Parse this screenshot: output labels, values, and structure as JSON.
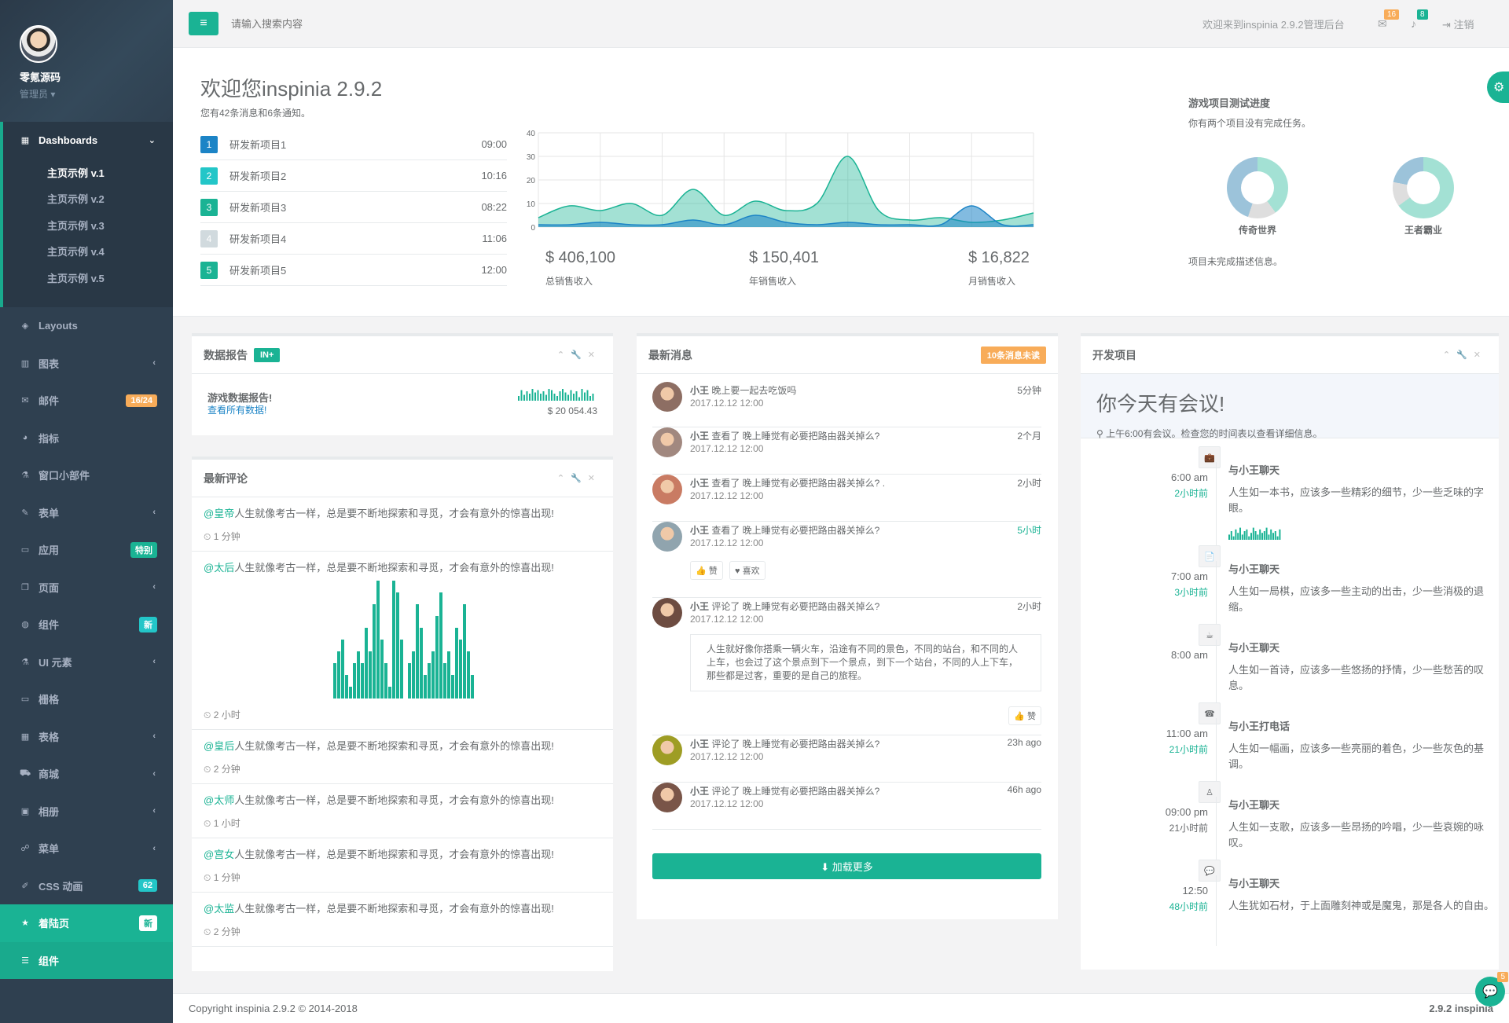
{
  "profile": {
    "name": "零氪源码",
    "role": "管理员 ▾"
  },
  "nav": {
    "dashboards": "Dashboards",
    "sub": [
      "主页示例 v.1",
      "主页示例 v.2",
      "主页示例 v.3",
      "主页示例 v.4",
      "主页示例 v.5"
    ],
    "items": [
      {
        "label": "Layouts",
        "icon": "◈",
        "arrow": "",
        "badge": "",
        "badge_class": ""
      },
      {
        "label": "图表",
        "icon": "▥",
        "arrow": "‹",
        "badge": "",
        "badge_class": ""
      },
      {
        "label": "邮件",
        "icon": "✉",
        "arrow": "",
        "badge": "16/24",
        "badge_class": "b-warn"
      },
      {
        "label": "指标",
        "icon": "◕",
        "arrow": "",
        "badge": "",
        "badge_class": ""
      },
      {
        "label": "窗口小部件",
        "icon": "⚗",
        "arrow": "",
        "badge": "",
        "badge_class": ""
      },
      {
        "label": "表单",
        "icon": "✎",
        "arrow": "‹",
        "badge": "",
        "badge_class": ""
      },
      {
        "label": "应用",
        "icon": "▭",
        "arrow": "",
        "badge": "特别",
        "badge_class": "b-pri"
      },
      {
        "label": "页面",
        "icon": "❐",
        "arrow": "‹",
        "badge": "",
        "badge_class": ""
      },
      {
        "label": "组件",
        "icon": "◍",
        "arrow": "",
        "badge": "新",
        "badge_class": "b-info"
      },
      {
        "label": "UI 元素",
        "icon": "⚗",
        "arrow": "‹",
        "badge": "",
        "badge_class": ""
      },
      {
        "label": "栅格",
        "icon": "▭",
        "arrow": "",
        "badge": "",
        "badge_class": ""
      },
      {
        "label": "表格",
        "icon": "▦",
        "arrow": "‹",
        "badge": "",
        "badge_class": ""
      },
      {
        "label": "商城",
        "icon": "⛟",
        "arrow": "‹",
        "badge": "",
        "badge_class": ""
      },
      {
        "label": "相册",
        "icon": "▣",
        "arrow": "‹",
        "badge": "",
        "badge_class": ""
      },
      {
        "label": "菜单",
        "icon": "☍",
        "arrow": "‹",
        "badge": "",
        "badge_class": ""
      },
      {
        "label": "CSS 动画",
        "icon": "✐",
        "arrow": "",
        "badge": "62",
        "badge_class": "b-info"
      }
    ],
    "landing": "着陆页",
    "landing_badge": "新",
    "bottom": "组件"
  },
  "topbar": {
    "search_placeholder": "请输入搜索内容",
    "welcome": "欢迎来到inspinia 2.9.2管理后台",
    "mail_count": "16",
    "bell_count": "8",
    "logout": "注销"
  },
  "hero": {
    "title": "欢迎您inspinia 2.9.2",
    "subtitle": "您有42条消息和6条通知。",
    "projects": [
      {
        "n": "1",
        "name": "研发新项目1",
        "time": "09:00",
        "color": "#1c84c6"
      },
      {
        "n": "2",
        "name": "研发新项目2",
        "time": "10:16",
        "color": "#23c6c8"
      },
      {
        "n": "3",
        "name": "研发新项目3",
        "time": "08:22",
        "color": "#1ab394"
      },
      {
        "n": "4",
        "name": "研发新项目4",
        "time": "11:06",
        "color": "#d1dade"
      },
      {
        "n": "5",
        "name": "研发新项目5",
        "time": "12:00",
        "color": "#1ab394"
      }
    ],
    "stats": [
      {
        "value": "$ 406,100",
        "label": "总销售收入"
      },
      {
        "value": "$ 150,401",
        "label": "年销售收入"
      },
      {
        "value": "$ 16,822",
        "label": "月销售收入"
      }
    ],
    "game_title": "游戏项目测试进度",
    "game_sub": "你有两个项目没有完成任务。",
    "game1": "传奇世界",
    "game2": "王者霸业",
    "game_foot": "项目未完成描述信息。"
  },
  "chart_data": {
    "type": "area",
    "xlim": [
      0,
      16
    ],
    "ylim": [
      0,
      40
    ],
    "xticks": [
      0,
      2,
      4,
      6,
      8,
      10,
      12,
      14,
      16
    ],
    "yticks": [
      0,
      10,
      20,
      30,
      40
    ],
    "x": [
      0,
      1,
      2,
      3,
      4,
      5,
      6,
      7,
      8,
      9,
      10,
      11,
      12,
      13,
      14,
      15,
      16
    ],
    "series": [
      {
        "color": "#1ab394",
        "values": [
          4,
          9,
          7,
          10,
          5,
          16,
          5,
          11,
          7,
          10,
          30,
          7,
          3,
          4,
          2,
          3,
          6
        ]
      },
      {
        "color": "#1c84c6",
        "values": [
          1,
          1,
          2,
          1,
          1,
          3,
          1,
          5,
          2,
          1,
          2,
          1,
          1,
          1,
          9,
          1,
          1
        ]
      }
    ]
  },
  "report": {
    "title": "数据报告",
    "tag": "IN+",
    "name": "游戏数据报告!",
    "link": "查看所有数据!",
    "amount": "$ 20 054.43",
    "spark": [
      4,
      9,
      5,
      8,
      6,
      10,
      7,
      9,
      6,
      8,
      5,
      10,
      9,
      6,
      4,
      8,
      10,
      7,
      5,
      9,
      6,
      8,
      3,
      10,
      7,
      9,
      4,
      6
    ]
  },
  "comments": {
    "title": "最新评论",
    "text": "人生就像考古一样，总是要不断地探索和寻觅，才会有意外的惊喜出现!",
    "items": [
      {
        "author": "@皇帝",
        "time": "⏲ 1 分钟"
      },
      {
        "author": "@太后",
        "time": "⏲ 2 小时"
      },
      {
        "author": "@皇后",
        "time": "⏲ 2 分钟"
      },
      {
        "author": "@太师",
        "time": "⏲ 1 小时"
      },
      {
        "author": "@宫女",
        "time": "⏲ 1 分钟"
      },
      {
        "author": "@太监",
        "time": "⏲ 2 分钟"
      }
    ],
    "bars": [
      3,
      4,
      5,
      2,
      1,
      3,
      4,
      3,
      6,
      4,
      8,
      10,
      5,
      3,
      1,
      10,
      9,
      5,
      0,
      3,
      4,
      8,
      6,
      2,
      3,
      4,
      7,
      9,
      3,
      4,
      2,
      6,
      5,
      8,
      4,
      2
    ]
  },
  "messages": {
    "title": "最新消息",
    "badge": "10条消息未读",
    "items": [
      {
        "who": "小王",
        "text": " 晚上要一起去吃饭吗",
        "date": "2017.12.12 12:00",
        "ago": "5分钟"
      },
      {
        "who": "小王",
        "text": " 查看了 晚上睡觉有必要把路由器关掉么?",
        "date": "2017.12.12 12:00",
        "ago": "2个月"
      },
      {
        "who": "小王",
        "text": " 查看了 晚上睡觉有必要把路由器关掉么? .",
        "date": "2017.12.12 12:00",
        "ago": "2小时"
      },
      {
        "who": "小王",
        "text": " 查看了 晚上睡觉有必要把路由器关掉么?",
        "date": "2017.12.12 12:00",
        "ago": "5小时"
      },
      {
        "who": "小王",
        "text": " 评论了 晚上睡觉有必要把路由器关掉么?",
        "date": "2017.12.12 12:00",
        "ago": "2小时"
      },
      {
        "who": "小王",
        "text": " 评论了 晚上睡觉有必要把路由器关掉么?",
        "date": "2017.12.12 12:00",
        "ago": "23h ago"
      },
      {
        "who": "小王",
        "text": " 评论了 晚上睡觉有必要把路由器关掉么?",
        "date": "2017.12.12 12:00",
        "ago": "46h ago"
      }
    ],
    "like": "👍 赞",
    "love": "♥ 喜欢",
    "quote": "人生就好像你搭乘一辆火车，沿途有不同的景色，不同的站台，和不同的人上车，也会过了这个景点到下一个景点，到下一个站台，不同的人上下车，那些都是过客，重要的是自己的旅程。",
    "zan": "👍 赞",
    "load": "⬇ 加载更多"
  },
  "dev": {
    "title": "开发项目",
    "head": "你今天有会议!",
    "head_sub": "⚲ 上午6:00有会议。检查您的时间表以查看详细信息。",
    "items": [
      {
        "icon": "💼",
        "time": "6:00 am",
        "rel": "2小时前",
        "title": "与小王聊天",
        "text": "人生如一本书，应该多一些精彩的细节，少一些乏味的字眼。",
        "rel_green": true
      },
      {
        "icon": "📄",
        "time": "7:00 am",
        "rel": "3小时前",
        "title": "与小王聊天",
        "text": "人生如一局棋，应该多一些主动的出击，少一些消极的退缩。",
        "rel_green": true
      },
      {
        "icon": "☕",
        "time": "8:00 am",
        "rel": "",
        "title": "与小王聊天",
        "text": "人生如一首诗，应该多一些悠扬的抒情，少一些愁苦的叹息。",
        "rel_green": true
      },
      {
        "icon": "☎",
        "time": "11:00 am",
        "rel": "21小时前",
        "title": "与小王打电话",
        "text": "人生如一幅画，应该多一些亮丽的着色，少一些灰色的基调。",
        "rel_green": true
      },
      {
        "icon": "♙",
        "time": "09:00 pm",
        "rel": "21小时前",
        "title": "与小王聊天",
        "text": "人生如一支歌，应该多一些昂扬的吟唱，少一些哀婉的咏叹。",
        "rel_green": false
      },
      {
        "icon": "💬",
        "time": "12:50",
        "rel": "48小时前",
        "title": "与小王聊天",
        "text": "人生犹如石材，于上面雕刻神或是魔鬼，那是各人的自由。",
        "rel_green": true
      }
    ],
    "spark": [
      3,
      5,
      2,
      6,
      4,
      7,
      3,
      5,
      6,
      2,
      4,
      7,
      5,
      3,
      6,
      4,
      5,
      7,
      3,
      6,
      4,
      5,
      2,
      6
    ]
  },
  "footer": {
    "left": "Copyright inspinia 2.9.2 © 2014-2018",
    "right": "2.9.2 inspinia"
  },
  "chat_count": "5"
}
